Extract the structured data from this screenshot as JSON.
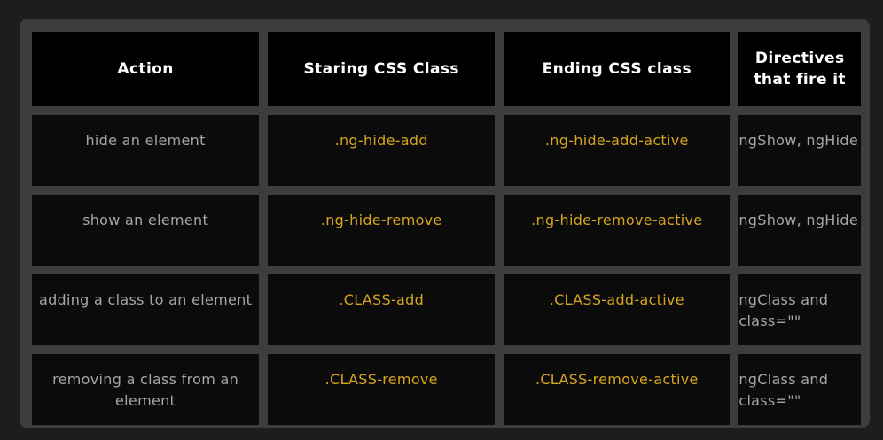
{
  "headers": {
    "action": "Action",
    "start": "Staring CSS Class",
    "end": "Ending CSS class",
    "directives": "Directives that fire it"
  },
  "rows": [
    {
      "action": "hide an element",
      "start": ".ng-hide-add",
      "end": ".ng-hide-add-active",
      "directives": "ngShow, ngHide"
    },
    {
      "action": "show an element",
      "start": ".ng-hide-remove",
      "end": ".ng-hide-remove-active",
      "directives": "ngShow, ngHide"
    },
    {
      "action": "adding a class to an element",
      "start": ".CLASS-add",
      "end": ".CLASS-add-active",
      "directives": "ngClass and class=\"\""
    },
    {
      "action": "removing a class from an element",
      "start": ".CLASS-remove",
      "end": ".CLASS-remove-active",
      "directives": "ngClass and class=\"\""
    }
  ],
  "colors": {
    "page_background": "#1d1d1d",
    "panel_background": "#3d3d3d",
    "header_background": "#000000",
    "cell_background": "#0b0b0b",
    "header_text": "#ffffff",
    "body_text": "#a6a6a6",
    "class_text": "#d6a420"
  }
}
